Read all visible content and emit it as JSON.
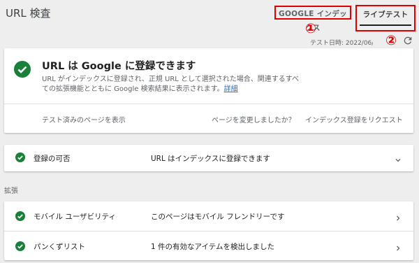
{
  "header": {
    "title": "URL 検査",
    "tab_index": "GOOGLE インデックス",
    "tab_live": "ライブテスト",
    "marker_1": "①",
    "marker_2": "②",
    "test_date": "テスト日時: 2022/06/0"
  },
  "main_card": {
    "title": "URL は Google に登録できます",
    "description": "URL がインデックスに登録され、正規 URL として選択された場合、関連するすべての拡張機能とともに Google 検索結果に表示されます。",
    "details_link": "詳細",
    "action_view": "テスト済みのページを表示",
    "action_changed": "ページを変更しましたか？",
    "action_request": "インデックス登録をリクエスト"
  },
  "coverage": {
    "label": "登録の可否",
    "value": "URL はインデックスに登録できます"
  },
  "enhancements": {
    "section_label": "拡張",
    "items": [
      {
        "label": "モバイル ユーザビリティ",
        "value": "このページはモバイル フレンドリーです"
      },
      {
        "label": "パンくずリスト",
        "value": "1 件の有効なアイテムを検出しました"
      }
    ]
  },
  "colors": {
    "success": "#188038",
    "annotation": "#e00000",
    "link": "#1a73e8"
  },
  "icons": [
    "check-circle-icon",
    "refresh-icon",
    "chevron-down-icon",
    "chevron-right-icon"
  ]
}
